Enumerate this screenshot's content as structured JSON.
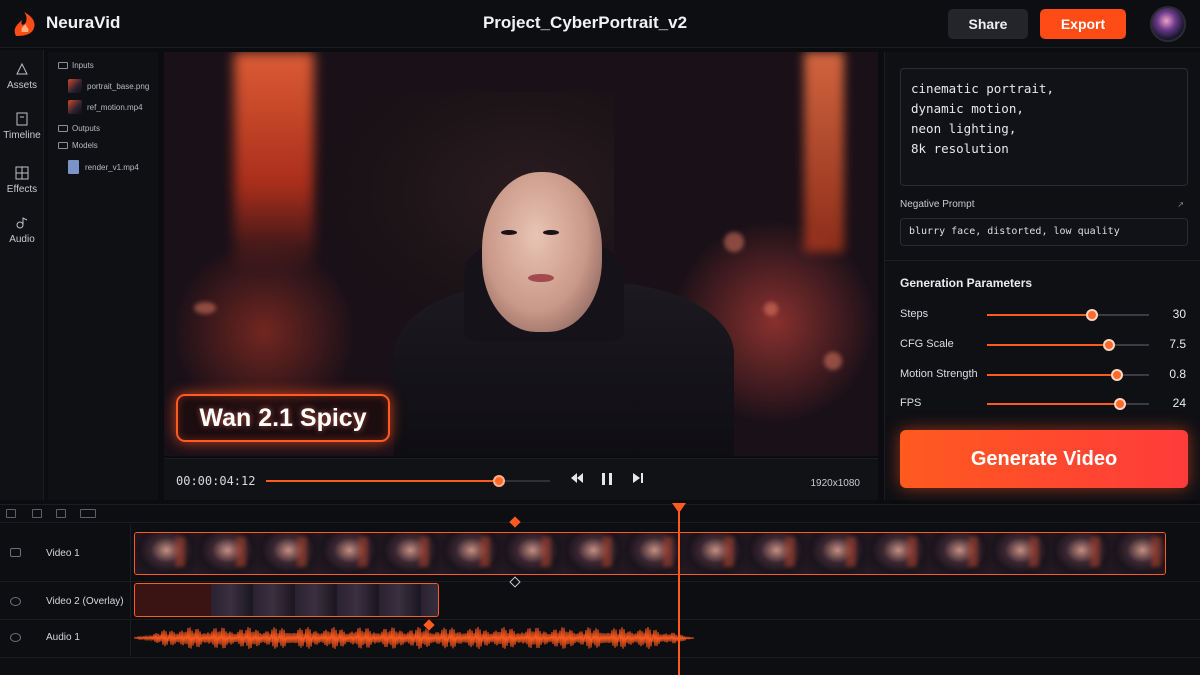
{
  "app": {
    "name": "NeuraVid",
    "logo_icon": "flame-logo-icon"
  },
  "header": {
    "project_title": "Project_CyberPortrait_v2",
    "share_label": "Share",
    "export_label": "Export"
  },
  "rail": {
    "items": [
      {
        "label": "Assets",
        "icon": "assets-icon"
      },
      {
        "label": "Timeline",
        "icon": "timeline-icon"
      },
      {
        "label": "Effects",
        "icon": "effects-icon"
      },
      {
        "label": "Audio",
        "icon": "audio-icon"
      }
    ]
  },
  "files": {
    "inputs_label": "Inputs",
    "input_files": [
      "portrait_base.png",
      "ref_motion.mp4"
    ],
    "outputs_label": "Outputs",
    "models_label": "Models",
    "model_files": [
      "render_v1.mp4"
    ]
  },
  "preview": {
    "badge_text": "Wan 2.1 Spicy"
  },
  "transport": {
    "timecode": "00:00:04:12",
    "progress": 0.82,
    "resolution": "1920x1080"
  },
  "prompt": {
    "text": "cinematic portrait,\ndynamic motion,\nneon lighting,\n8k resolution",
    "negative_label": "Negative Prompt",
    "negative_text": "blurry face, distorted, low quality"
  },
  "params": {
    "title": "Generation Parameters",
    "items": [
      {
        "label": "Steps",
        "value": "30",
        "fraction": 0.65
      },
      {
        "label": "CFG Scale",
        "value": "7.5",
        "fraction": 0.75
      },
      {
        "label": "Motion Strength",
        "value": "0.8",
        "fraction": 0.8
      },
      {
        "label": "FPS",
        "value": "24",
        "fraction": 0.82
      }
    ]
  },
  "generate_label": "Generate Video",
  "timeline": {
    "tracks": [
      {
        "name": "Video 1"
      },
      {
        "name": "Video 2 (Overlay)"
      },
      {
        "name": "Audio 1"
      }
    ]
  },
  "colors": {
    "accent": "#ff5a1f",
    "background": "#0b0c10",
    "panel": "#0f1014"
  }
}
